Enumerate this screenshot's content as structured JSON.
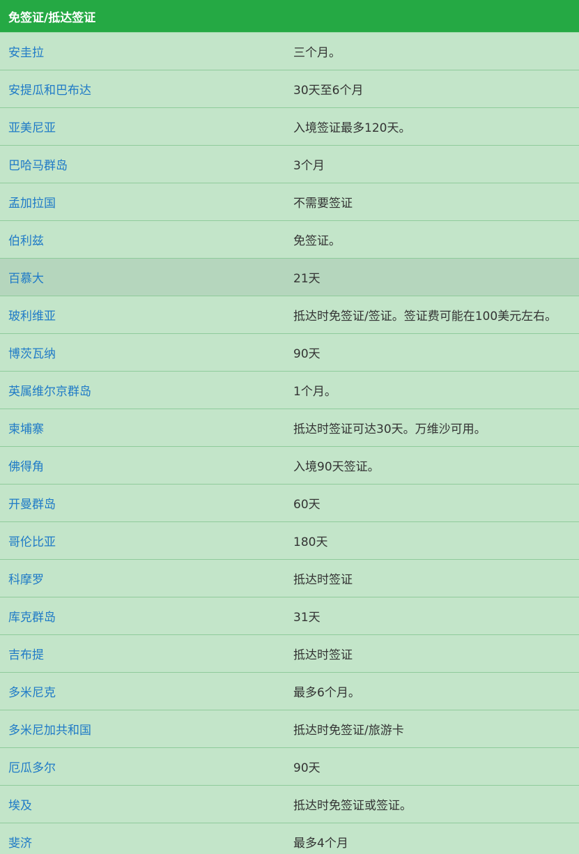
{
  "table": {
    "header": "免签证/抵达签证",
    "highlighted_row": 6,
    "rows": [
      {
        "country": "安圭拉",
        "policy": "三个月。"
      },
      {
        "country": "安提瓜和巴布达",
        "policy": "30天至6个月"
      },
      {
        "country": "亚美尼亚",
        "policy": "入境签证最多120天。"
      },
      {
        "country": "巴哈马群岛",
        "policy": "3个月"
      },
      {
        "country": "孟加拉国",
        "policy": "不需要签证"
      },
      {
        "country": "伯利兹",
        "policy": "免签证。"
      },
      {
        "country": "百慕大",
        "policy": "21天"
      },
      {
        "country": "玻利维亚",
        "policy": "抵达时免签证/签证。签证费可能在100美元左右。"
      },
      {
        "country": "博茨瓦纳",
        "policy": "90天"
      },
      {
        "country": "英属维尔京群岛",
        "policy": "1个月。"
      },
      {
        "country": "柬埔寨",
        "policy": "抵达时签证可达30天。万维沙可用。"
      },
      {
        "country": "佛得角",
        "policy": "入境90天签证。"
      },
      {
        "country": "开曼群岛",
        "policy": "60天"
      },
      {
        "country": "哥伦比亚",
        "policy": "180天"
      },
      {
        "country": "科摩罗",
        "policy": "抵达时签证"
      },
      {
        "country": "库克群岛",
        "policy": "31天"
      },
      {
        "country": "吉布提",
        "policy": "抵达时签证"
      },
      {
        "country": "多米尼克",
        "policy": "最多6个月。"
      },
      {
        "country": "多米尼加共和国",
        "policy": "抵达时免签证/旅游卡"
      },
      {
        "country": "厄瓜多尔",
        "policy": "90天"
      },
      {
        "country": "埃及",
        "policy": "抵达时免签证或签证。"
      },
      {
        "country": "斐济",
        "policy": "最多4个月"
      }
    ]
  },
  "colors": {
    "header_bg": "#25a944",
    "row_bg": "#c3e5c9",
    "row_highlight_bg": "#b5d6bd",
    "link": "#1f7ac7",
    "text": "#333333"
  }
}
